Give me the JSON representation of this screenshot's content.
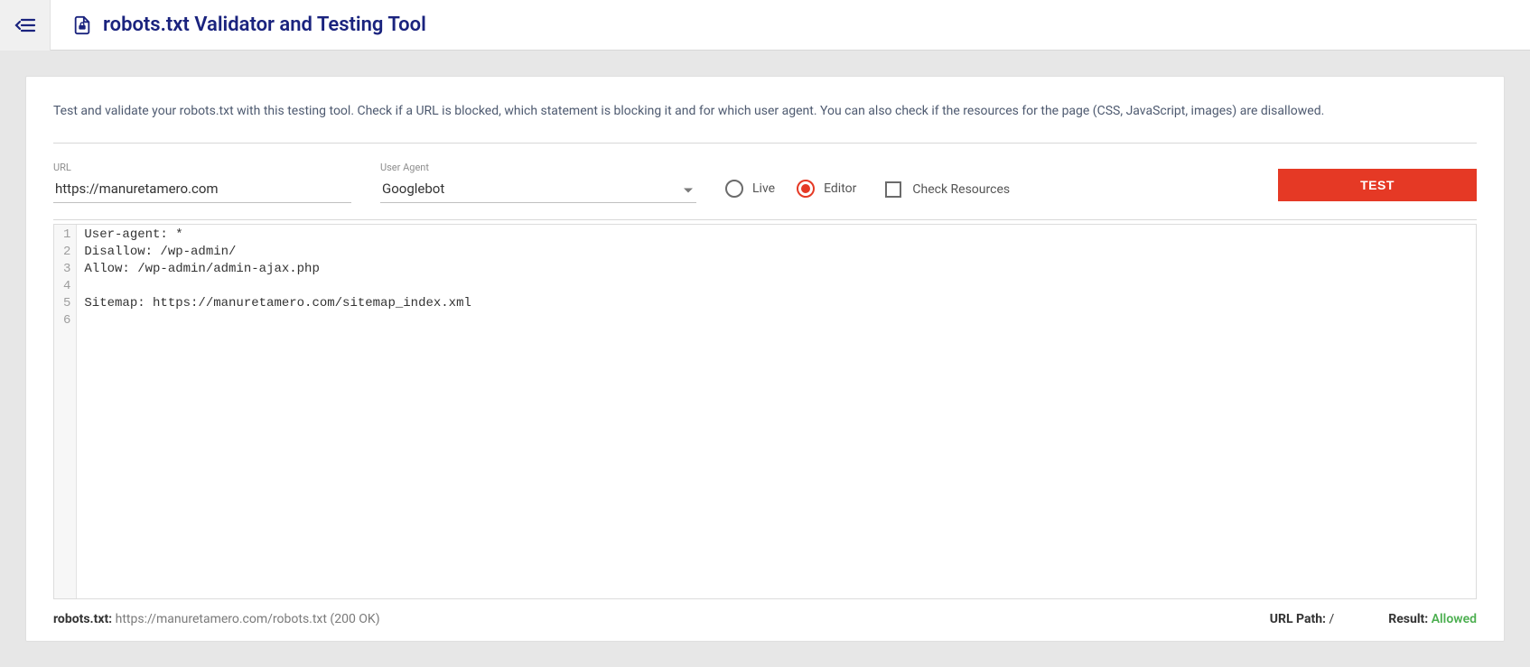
{
  "header": {
    "title": "robots.txt Validator and Testing Tool"
  },
  "intro": "Test and validate your robots.txt with this testing tool. Check if a URL is blocked, which statement is blocking it and for which user agent. You can also check if the resources for the page (CSS, JavaScript, images) are disallowed.",
  "form": {
    "url_label": "URL",
    "url_value": "https://manuretamero.com",
    "agent_label": "User Agent",
    "agent_value": "Googlebot",
    "mode_live": "Live",
    "mode_editor": "Editor",
    "check_resources": "Check Resources",
    "test_button": "TEST"
  },
  "editor": {
    "lines": [
      "User-agent: *",
      "Disallow: /wp-admin/",
      "Allow: /wp-admin/admin-ajax.php",
      "",
      "Sitemap: https://manuretamero.com/sitemap_index.xml",
      ""
    ]
  },
  "status": {
    "robots_label": "robots.txt:",
    "robots_value": "https://manuretamero.com/robots.txt (200 OK)",
    "path_label": "URL Path:",
    "path_value": "/",
    "result_label": "Result:",
    "result_value": "Allowed"
  }
}
